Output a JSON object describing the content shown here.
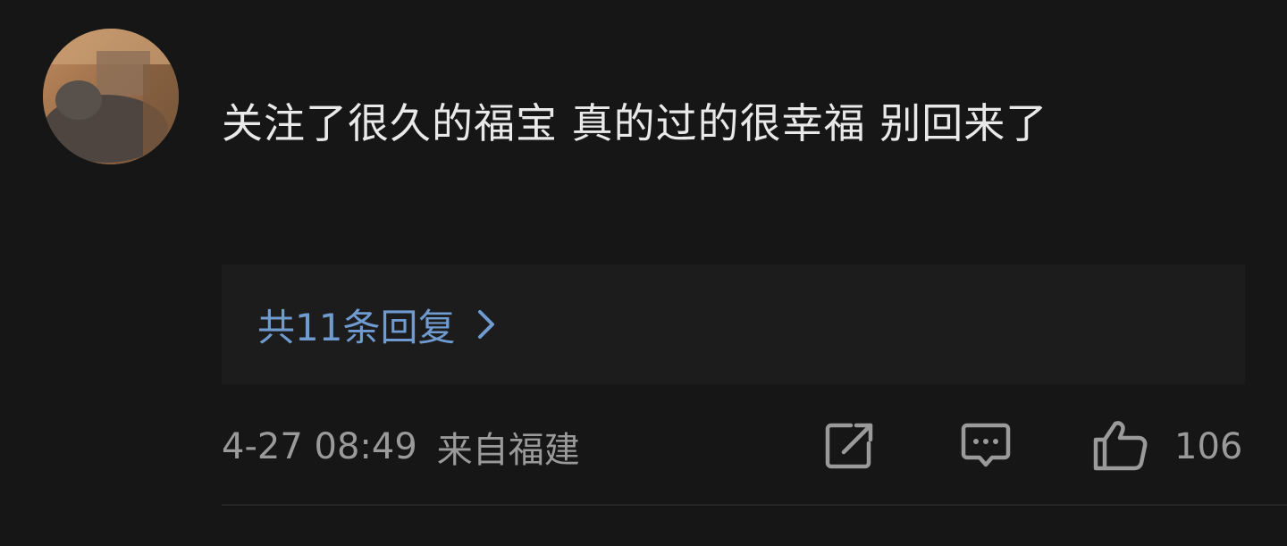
{
  "comment": {
    "text": "关注了很久的福宝 真的过的很幸福 别回来了",
    "replies_label": "共11条回复",
    "timestamp": "4-27 08:49",
    "location": "来自福建",
    "like_count": "106"
  },
  "icons": {
    "avatar": "user-avatar-photo",
    "chevron": "chevron-right-icon",
    "share": "share-icon",
    "comment": "comment-icon",
    "like": "thumbs-up-icon"
  },
  "colors": {
    "background": "#161616",
    "replies_background": "#1c1c1c",
    "link": "#6f9bd0",
    "secondary_text": "#9a9a9a",
    "primary_text": "#e9e9e9"
  }
}
